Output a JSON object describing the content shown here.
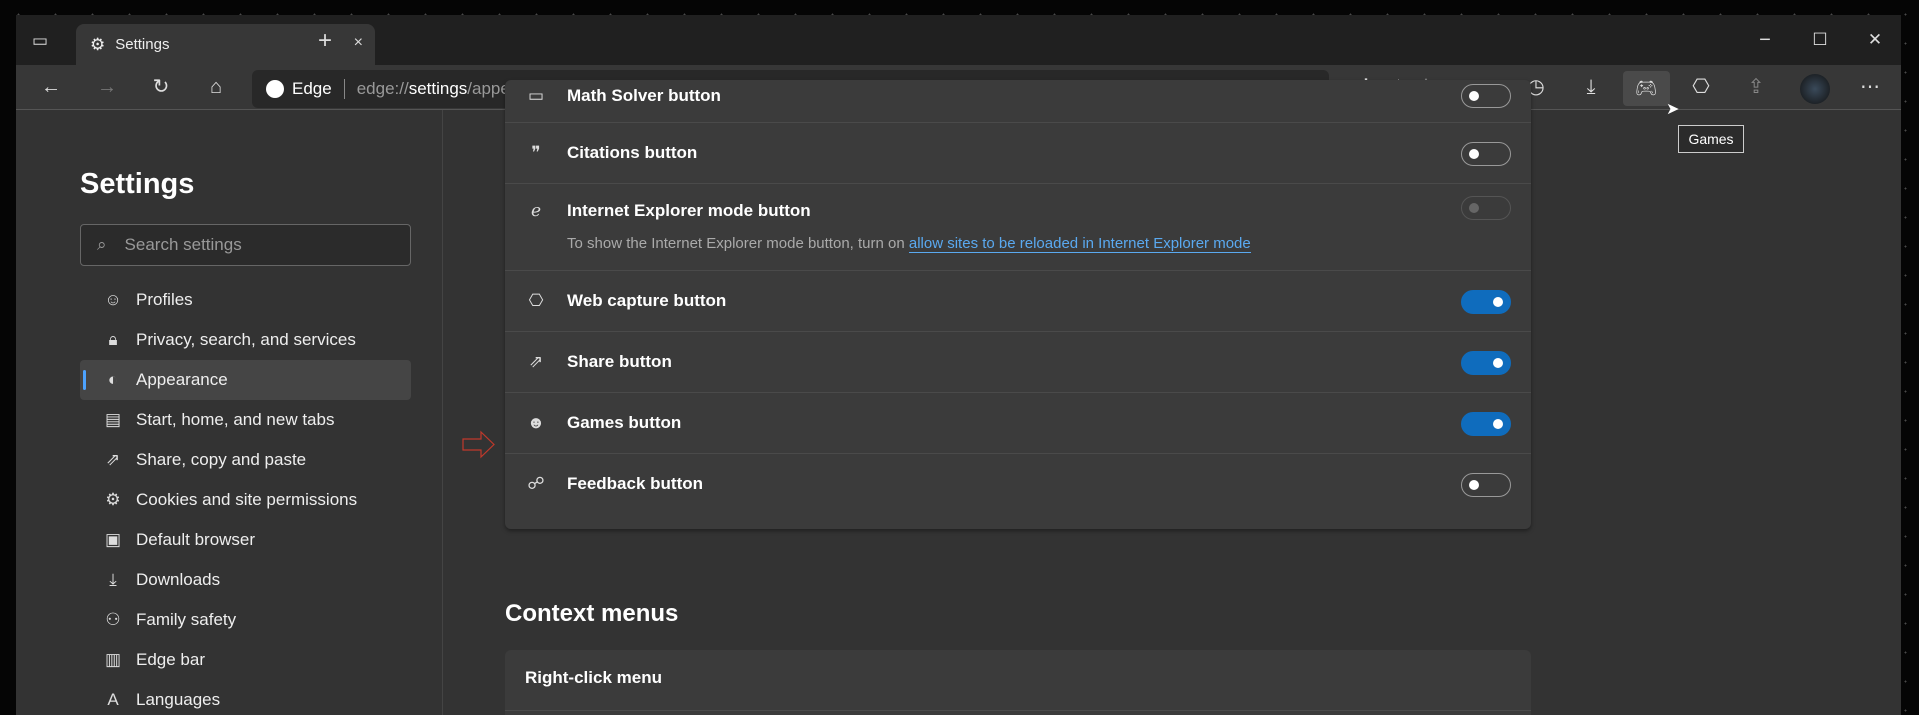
{
  "tab": {
    "title": "Settings",
    "close": "×",
    "new_tab": "+"
  },
  "window": {
    "minimize": "−",
    "maximize": "☐",
    "close": "✕"
  },
  "address": {
    "brand": "Edge",
    "url_prefix": "edge://",
    "url_host": "settings",
    "url_path": "/appearance"
  },
  "tooltip": "Games",
  "sidebar": {
    "title": "Settings",
    "search_placeholder": "Search settings",
    "items": [
      {
        "label": "Profiles",
        "icon": "profile-icon"
      },
      {
        "label": "Privacy, search, and services",
        "icon": "lock-icon"
      },
      {
        "label": "Appearance",
        "icon": "palette-icon",
        "selected": true
      },
      {
        "label": "Start, home, and new tabs",
        "icon": "start-tabs-icon"
      },
      {
        "label": "Share, copy and paste",
        "icon": "share-icon"
      },
      {
        "label": "Cookies and site permissions",
        "icon": "cookies-icon"
      },
      {
        "label": "Default browser",
        "icon": "default-browser-icon"
      },
      {
        "label": "Downloads",
        "icon": "download-icon"
      },
      {
        "label": "Family safety",
        "icon": "family-icon"
      },
      {
        "label": "Edge bar",
        "icon": "edge-bar-icon"
      },
      {
        "label": "Languages",
        "icon": "languages-icon"
      }
    ]
  },
  "toolbar_rows": [
    {
      "label": "Math Solver button",
      "on": false
    },
    {
      "label": "Citations button",
      "on": false
    },
    {
      "label": "Internet Explorer mode button",
      "on": false,
      "disabled": true,
      "desc": "To show the Internet Explorer mode button, turn on ",
      "link": "allow sites to be reloaded in Internet Explorer mode"
    },
    {
      "label": "Web capture button",
      "on": true
    },
    {
      "label": "Share button",
      "on": true
    },
    {
      "label": "Games button",
      "on": true
    },
    {
      "label": "Feedback button",
      "on": false
    }
  ],
  "context_menus": {
    "heading": "Context menus",
    "right_click": "Right-click menu"
  },
  "colors": {
    "accent": "#0f6cbd",
    "link": "#5aa9f0",
    "annotation_arrow": "#c0392b"
  }
}
